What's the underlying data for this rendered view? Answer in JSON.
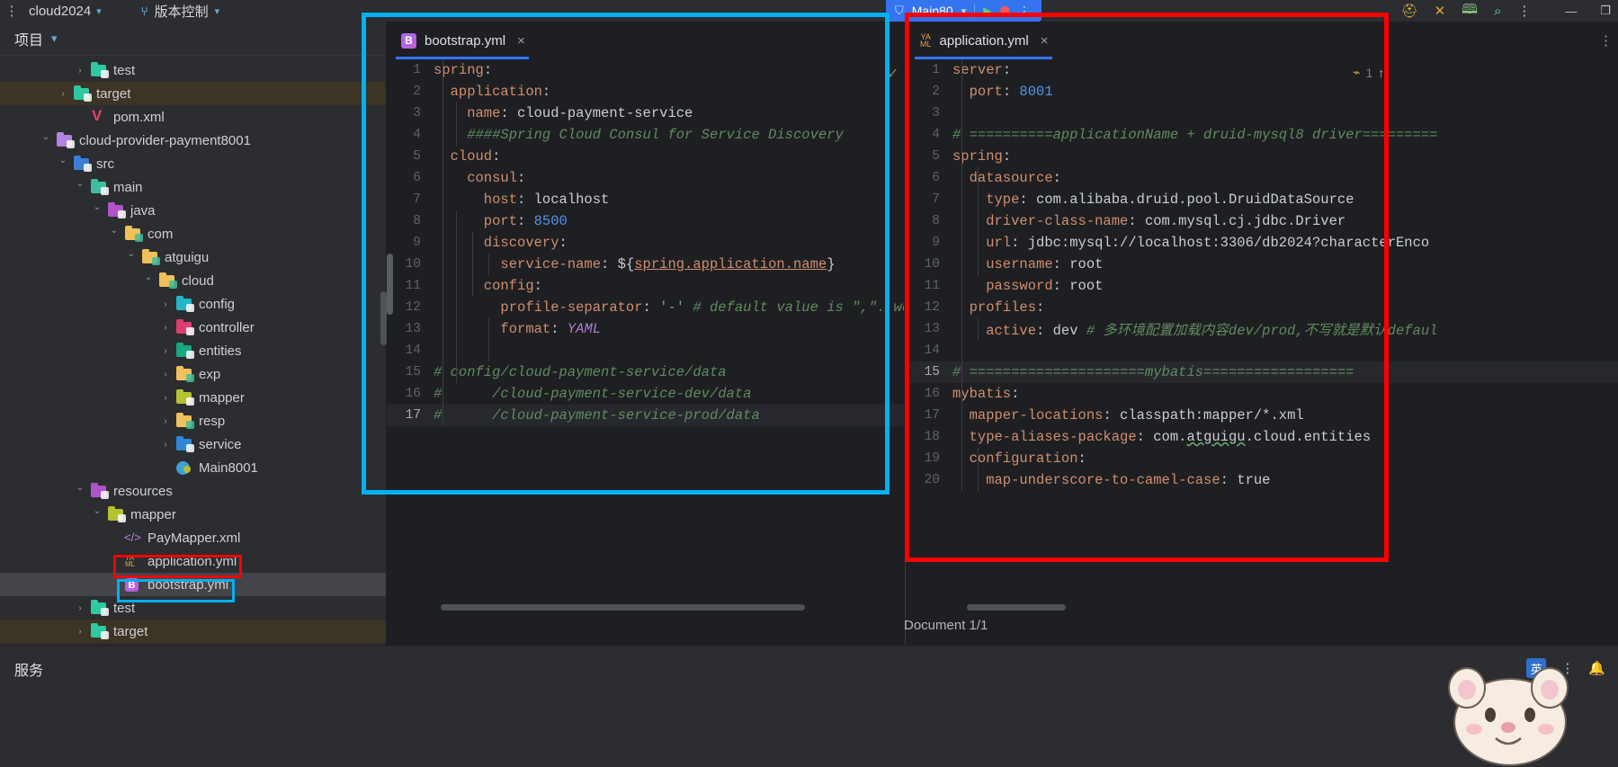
{
  "topbar": {
    "kebab_icon": "more-vertical-icon",
    "project_name": "cloud2024",
    "vcs_label": "版本控制",
    "run_config": "Main80",
    "icons": [
      "shield-icon",
      "run-icon",
      "debug-icon",
      "more-vertical-icon",
      "helmet-icon",
      "tools-icon",
      "bug-search-icon",
      "search-icon",
      "more-icon"
    ],
    "window_controls": [
      "minimize",
      "restore",
      "close"
    ]
  },
  "project_panel": {
    "title": "项目",
    "tree": [
      {
        "label": "test",
        "depth": 4,
        "arrow": "closed",
        "icon": "folder-test",
        "color": "#2dc9a0"
      },
      {
        "label": "target",
        "depth": 3,
        "arrow": "closed",
        "icon": "folder-target",
        "color": "#2dc9a0",
        "state": "highlight"
      },
      {
        "label": "pom.xml",
        "depth": 4,
        "arrow": "none",
        "icon": "maven-icon",
        "color": "#e8436f"
      },
      {
        "label": "cloud-provider-payment8001",
        "depth": 2,
        "arrow": "open",
        "icon": "folder-module",
        "color": "#b284e0"
      },
      {
        "label": "src",
        "depth": 3,
        "arrow": "open",
        "icon": "folder-src",
        "color": "#3b7fd4"
      },
      {
        "label": "main",
        "depth": 4,
        "arrow": "open",
        "icon": "folder-main",
        "color": "#3fbda0"
      },
      {
        "label": "java",
        "depth": 5,
        "arrow": "open",
        "icon": "folder-java",
        "color": "#b054c9"
      },
      {
        "label": "com",
        "depth": 6,
        "arrow": "open",
        "icon": "folder-package",
        "color": "#f0c05a"
      },
      {
        "label": "atguigu",
        "depth": 7,
        "arrow": "open",
        "icon": "folder-package",
        "color": "#f0c05a"
      },
      {
        "label": "cloud",
        "depth": 8,
        "arrow": "open",
        "icon": "folder-package",
        "color": "#f0c05a"
      },
      {
        "label": "config",
        "depth": 9,
        "arrow": "closed",
        "icon": "folder-config",
        "color": "#21b5c7"
      },
      {
        "label": "controller",
        "depth": 9,
        "arrow": "closed",
        "icon": "folder-controller",
        "color": "#e03c74"
      },
      {
        "label": "entities",
        "depth": 9,
        "arrow": "closed",
        "icon": "folder-entities",
        "color": "#18a77e"
      },
      {
        "label": "exp",
        "depth": 9,
        "arrow": "closed",
        "icon": "folder-package",
        "color": "#f0c05a"
      },
      {
        "label": "mapper",
        "depth": 9,
        "arrow": "closed",
        "icon": "folder-mapper",
        "color": "#b5c22e"
      },
      {
        "label": "resp",
        "depth": 9,
        "arrow": "closed",
        "icon": "folder-package",
        "color": "#f0c05a"
      },
      {
        "label": "service",
        "depth": 9,
        "arrow": "closed",
        "icon": "folder-service",
        "color": "#2f86d6"
      },
      {
        "label": "Main8001",
        "depth": 9,
        "arrow": "none",
        "icon": "java-class-icon",
        "color": "#4aa3d8"
      },
      {
        "label": "resources",
        "depth": 4,
        "arrow": "open",
        "icon": "folder-resources",
        "color": "#b054c9"
      },
      {
        "label": "mapper",
        "depth": 5,
        "arrow": "open",
        "icon": "folder-mapper",
        "color": "#b5c22e"
      },
      {
        "label": "PayMapper.xml",
        "depth": 6,
        "arrow": "none",
        "icon": "xml-icon",
        "color": "#c97ae0"
      },
      {
        "label": "application.yml",
        "depth": 6,
        "arrow": "none",
        "icon": "yaml-icon",
        "color": "#e8a33d",
        "state": "marked-red"
      },
      {
        "label": "bootstrap.yml",
        "depth": 6,
        "arrow": "none",
        "icon": "bootstrap-icon",
        "color": "#b06ae6",
        "state": "selected-cyan"
      },
      {
        "label": "test",
        "depth": 4,
        "arrow": "closed",
        "icon": "folder-test",
        "color": "#2dc9a0"
      },
      {
        "label": "target",
        "depth": 4,
        "arrow": "closed",
        "icon": "folder-target",
        "color": "#2dc9a0",
        "state": "highlight"
      }
    ]
  },
  "left_editor": {
    "tab": {
      "label": "bootstrap.yml",
      "icon": "bootstrap-icon",
      "close": "×",
      "active": true
    },
    "kebab_icon": "more-vertical-icon",
    "lines": [
      {
        "no": "1",
        "segments": [
          {
            "t": "spring",
            "c": "k"
          },
          {
            "t": ":",
            "c": "v"
          }
        ]
      },
      {
        "no": "2",
        "segments": [
          {
            "t": "  application",
            "c": "k"
          },
          {
            "t": ":",
            "c": "v"
          }
        ]
      },
      {
        "no": "3",
        "segments": [
          {
            "t": "    name",
            "c": "k"
          },
          {
            "t": ": ",
            "c": "v"
          },
          {
            "t": "cloud-payment-service",
            "c": "v"
          }
        ]
      },
      {
        "no": "4",
        "segments": [
          {
            "t": "    ####Spring Cloud Consul for Service Discovery",
            "c": "ci"
          }
        ]
      },
      {
        "no": "5",
        "segments": [
          {
            "t": "  cloud",
            "c": "k"
          },
          {
            "t": ":",
            "c": "v"
          }
        ]
      },
      {
        "no": "6",
        "segments": [
          {
            "t": "    consul",
            "c": "k"
          },
          {
            "t": ":",
            "c": "v"
          }
        ]
      },
      {
        "no": "7",
        "segments": [
          {
            "t": "      host",
            "c": "k"
          },
          {
            "t": ": ",
            "c": "v"
          },
          {
            "t": "localhost",
            "c": "v"
          }
        ]
      },
      {
        "no": "8",
        "segments": [
          {
            "t": "      port",
            "c": "k"
          },
          {
            "t": ": ",
            "c": "v"
          },
          {
            "t": "8500",
            "c": "n"
          }
        ]
      },
      {
        "no": "9",
        "segments": [
          {
            "t": "      discovery",
            "c": "k"
          },
          {
            "t": ":",
            "c": "v"
          }
        ]
      },
      {
        "no": "10",
        "segments": [
          {
            "t": "        service-name",
            "c": "k"
          },
          {
            "t": ": ",
            "c": "v"
          },
          {
            "t": "${",
            "c": "v"
          },
          {
            "t": "spring.application.name",
            "c": "lnk"
          },
          {
            "t": "}",
            "c": "v"
          }
        ]
      },
      {
        "no": "11",
        "segments": [
          {
            "t": "      config",
            "c": "k"
          },
          {
            "t": ":",
            "c": "v"
          }
        ]
      },
      {
        "no": "12",
        "segments": [
          {
            "t": "        profile-separator",
            "c": "k"
          },
          {
            "t": ": ",
            "c": "v"
          },
          {
            "t": "'-'",
            "c": "str"
          },
          {
            "t": " # default value is \",\". we up",
            "c": "ci"
          }
        ]
      },
      {
        "no": "13",
        "segments": [
          {
            "t": "        format",
            "c": "k"
          },
          {
            "t": ": ",
            "c": "v"
          },
          {
            "t": "YAML",
            "c": "yamlkw"
          }
        ]
      },
      {
        "no": "14",
        "segments": []
      },
      {
        "no": "15",
        "segments": [
          {
            "t": "# config/cloud-payment-service/data",
            "c": "ci"
          }
        ]
      },
      {
        "no": "16",
        "segments": [
          {
            "t": "#      /cloud-payment-service-dev/data",
            "c": "ci"
          }
        ]
      },
      {
        "no": "17",
        "segments": [
          {
            "t": "#      /cloud-payment-service-prod/data",
            "c": "ci"
          }
        ],
        "highlight": true
      }
    ]
  },
  "right_editor": {
    "tab": {
      "label": "application.yml",
      "icon": "yaml-icon",
      "close": "×",
      "active": true
    },
    "kebab_icon": "more-vertical-icon",
    "inspection": {
      "count": "1",
      "icon": "inspection-icon",
      "arrow": "↑"
    },
    "lines": [
      {
        "no": "1",
        "segments": [
          {
            "t": "server",
            "c": "k"
          },
          {
            "t": ":",
            "c": "v"
          }
        ]
      },
      {
        "no": "2",
        "segments": [
          {
            "t": "  port",
            "c": "k"
          },
          {
            "t": ": ",
            "c": "v"
          },
          {
            "t": "8001",
            "c": "n"
          }
        ]
      },
      {
        "no": "3",
        "segments": []
      },
      {
        "no": "4",
        "segments": [
          {
            "t": "# ==========applicationName + druid-mysql8 driver=========",
            "c": "ci"
          }
        ]
      },
      {
        "no": "5",
        "segments": [
          {
            "t": "spring",
            "c": "k"
          },
          {
            "t": ":",
            "c": "v"
          }
        ]
      },
      {
        "no": "6",
        "segments": [
          {
            "t": "  datasource",
            "c": "k"
          },
          {
            "t": ":",
            "c": "v"
          }
        ]
      },
      {
        "no": "7",
        "segments": [
          {
            "t": "    type",
            "c": "k"
          },
          {
            "t": ": ",
            "c": "v"
          },
          {
            "t": "com.alibaba.druid.pool.DruidDataSource",
            "c": "v"
          }
        ]
      },
      {
        "no": "8",
        "segments": [
          {
            "t": "    driver-class-name",
            "c": "k"
          },
          {
            "t": ": ",
            "c": "v"
          },
          {
            "t": "com.mysql.cj.jdbc.Driver",
            "c": "v"
          }
        ]
      },
      {
        "no": "9",
        "segments": [
          {
            "t": "    url",
            "c": "k"
          },
          {
            "t": ": ",
            "c": "v"
          },
          {
            "t": "jdbc:mysql://localhost:3306/db2024?characterEnco",
            "c": "v"
          }
        ]
      },
      {
        "no": "10",
        "segments": [
          {
            "t": "    username",
            "c": "k"
          },
          {
            "t": ": ",
            "c": "v"
          },
          {
            "t": "root",
            "c": "v"
          }
        ]
      },
      {
        "no": "11",
        "segments": [
          {
            "t": "    password",
            "c": "k"
          },
          {
            "t": ": ",
            "c": "v"
          },
          {
            "t": "root",
            "c": "v"
          }
        ]
      },
      {
        "no": "12",
        "segments": [
          {
            "t": "  profiles",
            "c": "k"
          },
          {
            "t": ":",
            "c": "v"
          }
        ]
      },
      {
        "no": "13",
        "segments": [
          {
            "t": "    active",
            "c": "k"
          },
          {
            "t": ": ",
            "c": "v"
          },
          {
            "t": "dev",
            "c": "v"
          },
          {
            "t": " # 多环境配置加载内容dev/prod,不写就是默认defaul",
            "c": "ci"
          }
        ]
      },
      {
        "no": "14",
        "segments": []
      },
      {
        "no": "15",
        "segments": [
          {
            "t": "# =====================mybatis==================",
            "c": "ci"
          }
        ],
        "highlight": true
      },
      {
        "no": "16",
        "segments": [
          {
            "t": "mybatis",
            "c": "k"
          },
          {
            "t": ":",
            "c": "v"
          }
        ]
      },
      {
        "no": "17",
        "segments": [
          {
            "t": "  mapper-locations",
            "c": "k"
          },
          {
            "t": ": ",
            "c": "v"
          },
          {
            "t": "classpath:mapper/*.xml",
            "c": "v"
          }
        ]
      },
      {
        "no": "18",
        "segments": [
          {
            "t": "  type-aliases-package",
            "c": "k"
          },
          {
            "t": ": ",
            "c": "v"
          },
          {
            "t": "com.",
            "c": "v"
          },
          {
            "t": "atguigu",
            "c": "sq"
          },
          {
            "t": ".cloud.entities",
            "c": "v"
          }
        ]
      },
      {
        "no": "19",
        "segments": [
          {
            "t": "  configuration",
            "c": "k"
          },
          {
            "t": ":",
            "c": "v"
          }
        ]
      },
      {
        "no": "20",
        "segments": [
          {
            "t": "    map-underscore-to-camel-case",
            "c": "k"
          },
          {
            "t": ": ",
            "c": "v"
          },
          {
            "t": "true",
            "c": "v"
          }
        ]
      }
    ]
  },
  "status": {
    "document_label": "Document 1/1"
  },
  "bottombar": {
    "services_label": "服务",
    "ime_label": "英",
    "icons": [
      "more-vertical-icon",
      "bell-icon"
    ]
  },
  "annotations": {
    "cyan_color": "#00b0f0",
    "red_color": "#ff0000"
  }
}
